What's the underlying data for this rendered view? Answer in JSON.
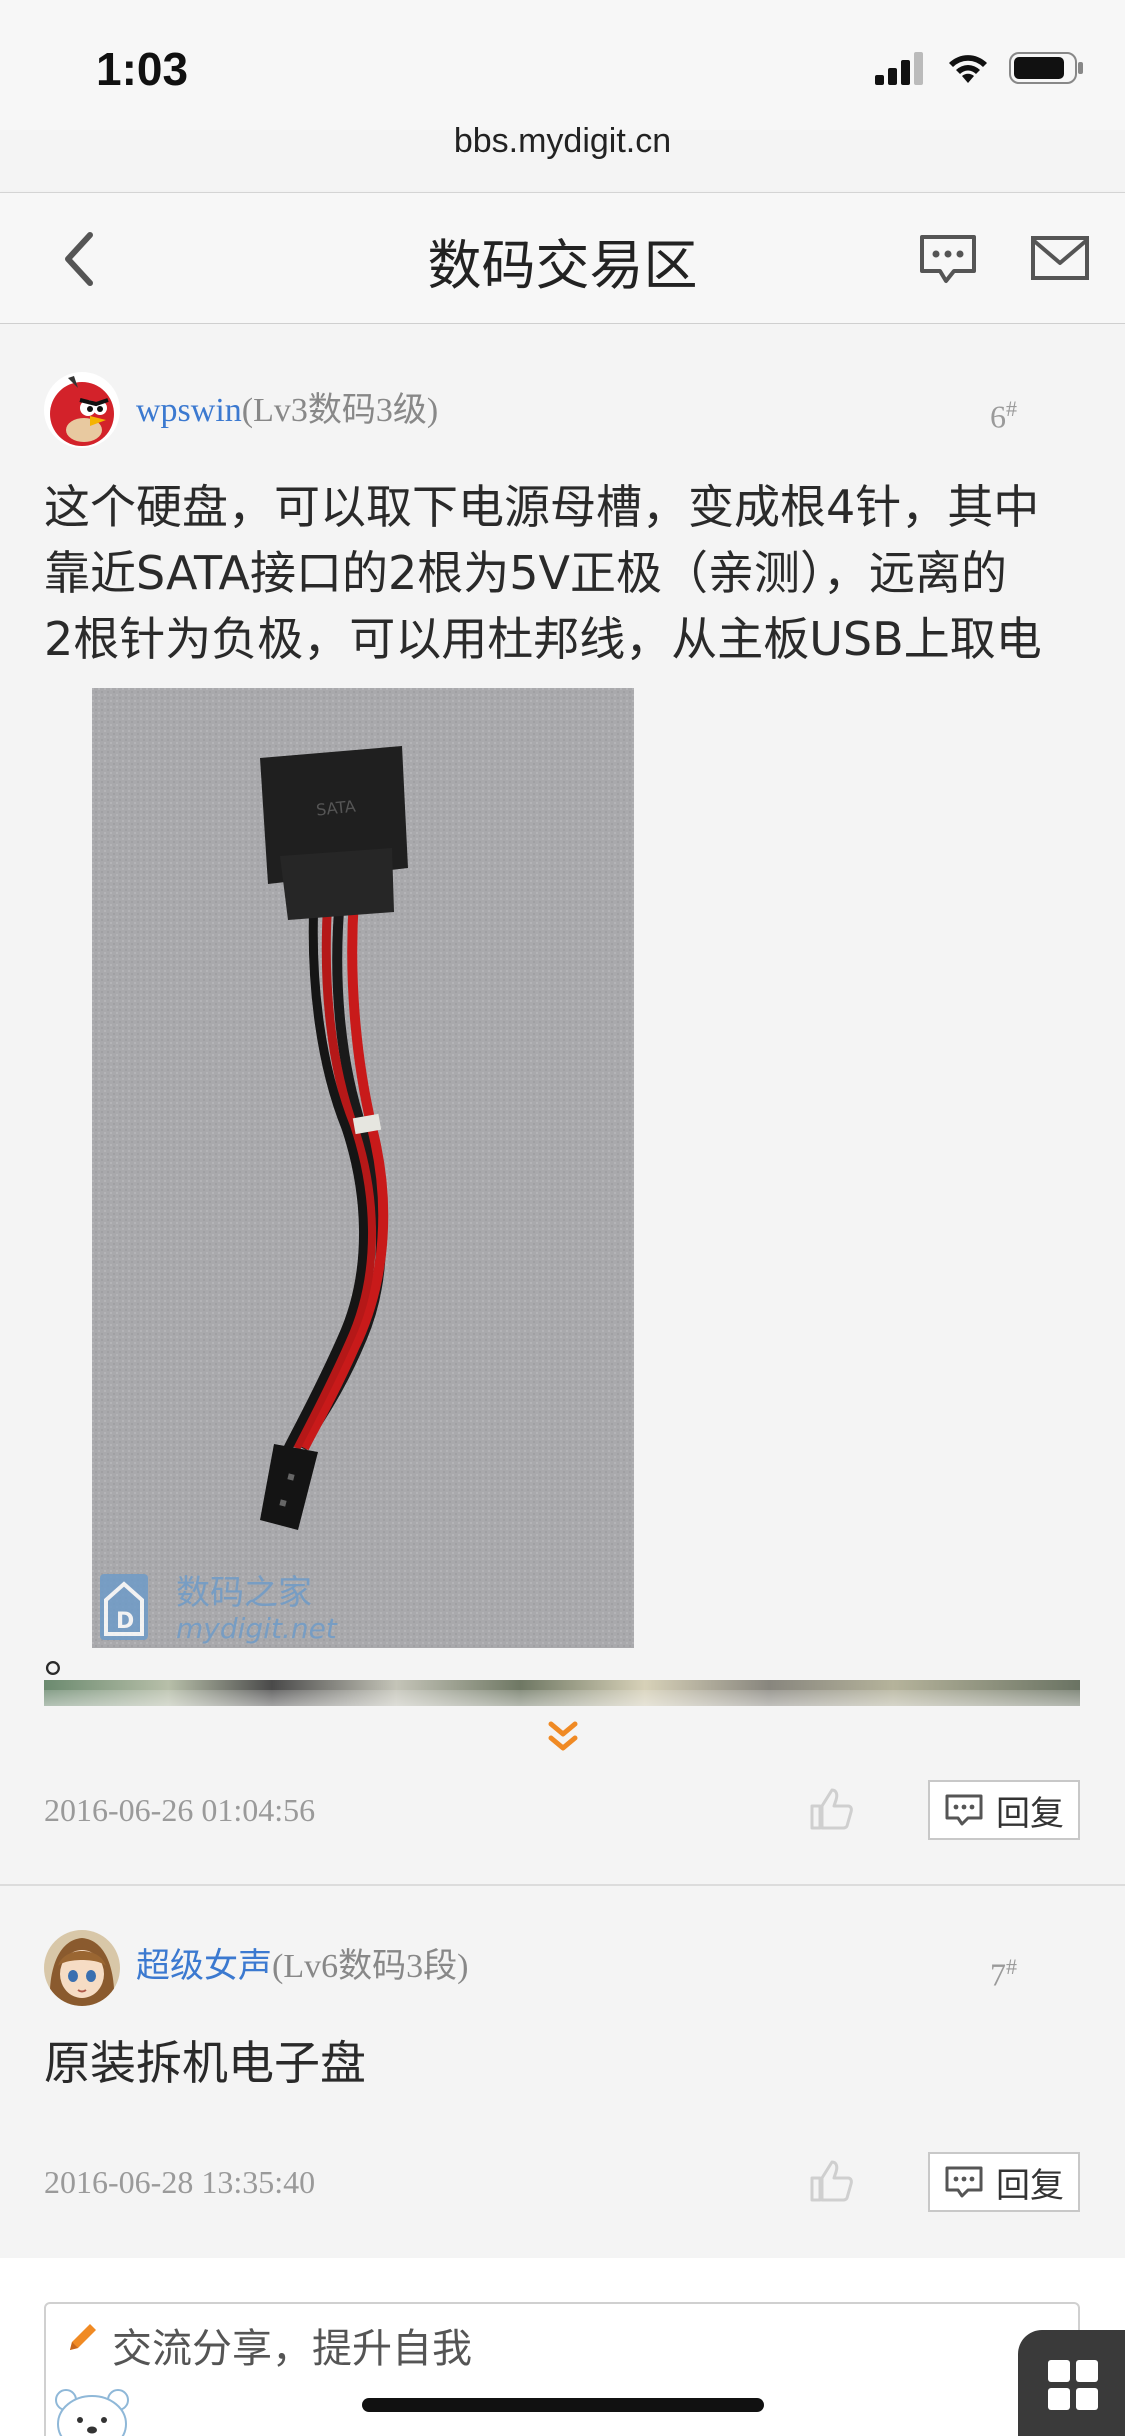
{
  "status_bar": {
    "time": "1:03"
  },
  "browser": {
    "url": "bbs.mydigit.cn"
  },
  "nav": {
    "title": "数码交易区"
  },
  "posts": [
    {
      "username": "wpswin",
      "level": "(Lv3数码3级)",
      "floor": "6",
      "floor_mark": "#",
      "content_lines": [
        "这个硬盘，可以取下电源母槽，变成根4针，其中",
        "靠近SATA接口的2根为5V正极（亲测），远离的",
        "2根针为负极，可以用杜邦线，从主板USB上取电"
      ],
      "content_tail": "。",
      "image_watermark_title": "数码之家",
      "image_watermark_url": "mydigit.net",
      "connector_label": "SATA",
      "timestamp": "2016-06-26 01:04:56",
      "reply_label": "回复"
    },
    {
      "username": "超级女声",
      "level": "(Lv6数码3段)",
      "floor": "7",
      "floor_mark": "#",
      "content_lines": [
        "原装拆机电子盘"
      ],
      "timestamp": "2016-06-28 13:35:40",
      "reply_label": "回复"
    }
  ],
  "reply_input": {
    "placeholder": "交流分享，提升自我"
  },
  "colors": {
    "link": "#3b79d0",
    "accent": "#f08a24",
    "meta": "#9a9a9a"
  }
}
